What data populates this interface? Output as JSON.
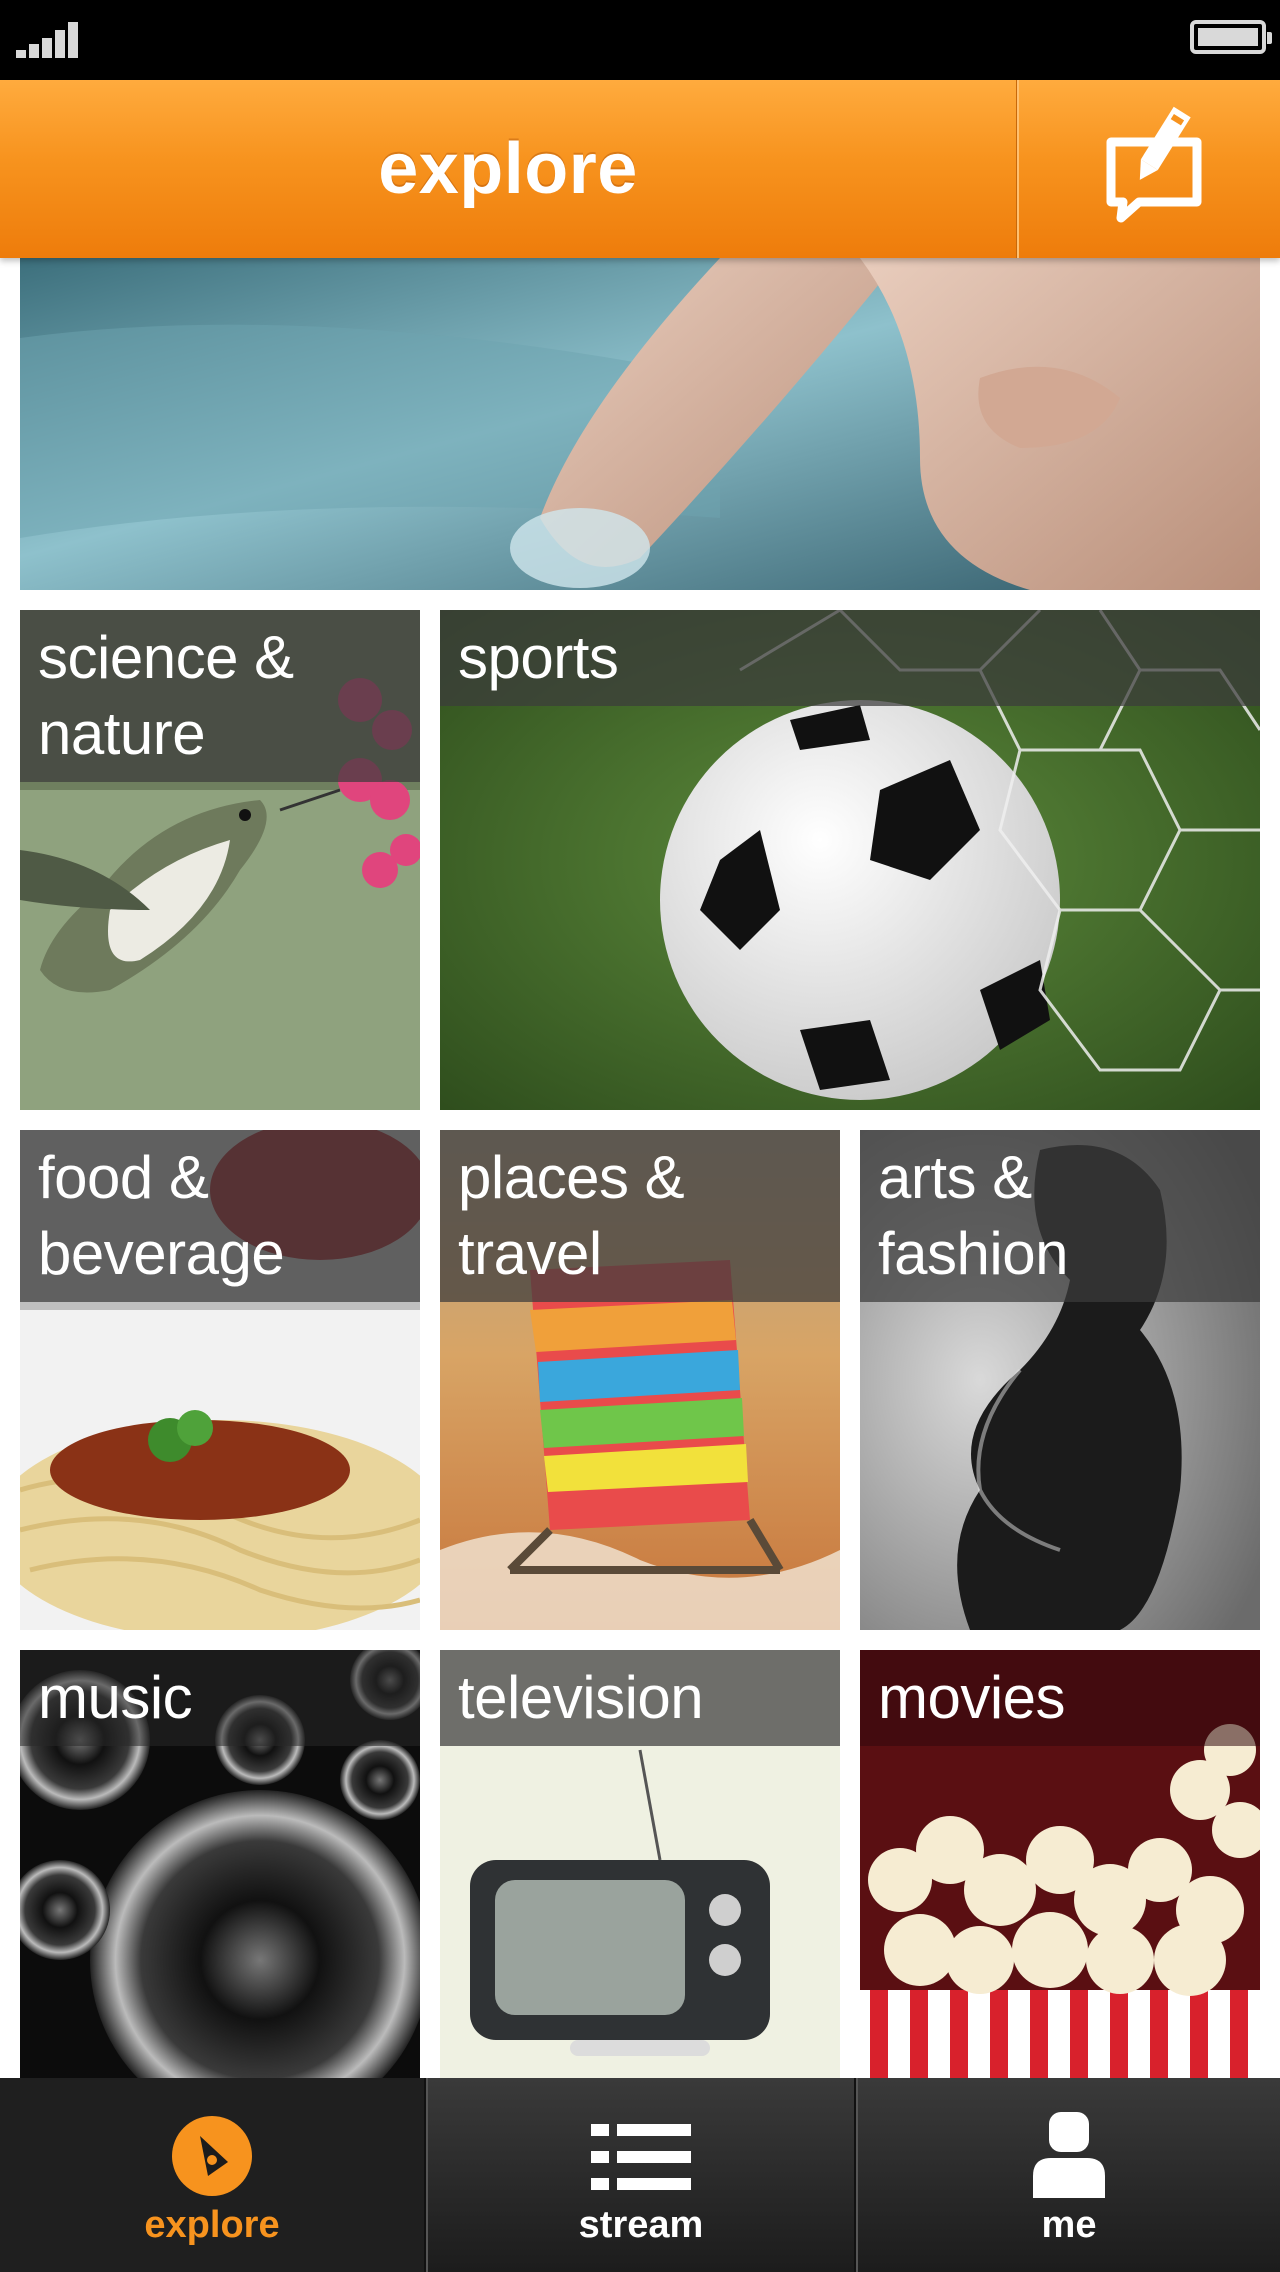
{
  "header": {
    "title": "explore",
    "compose_icon": "compose-bubble-pencil-icon"
  },
  "status_bar": {
    "signal_icon": "signal-strength-icon",
    "battery_icon": "battery-icon"
  },
  "banner": {
    "alt": "hero-banner"
  },
  "categories": [
    {
      "label_line1": "science &",
      "label_line2": "nature"
    },
    {
      "label_line1": "sports",
      "label_line2": ""
    },
    {
      "label_line1": "food &",
      "label_line2": "beverage"
    },
    {
      "label_line1": "places &",
      "label_line2": "travel"
    },
    {
      "label_line1": "arts &",
      "label_line2": "fashion"
    },
    {
      "label_line1": "music",
      "label_line2": ""
    },
    {
      "label_line1": "television",
      "label_line2": ""
    },
    {
      "label_line1": "movies",
      "label_line2": ""
    }
  ],
  "nav": {
    "items": [
      {
        "label": "explore",
        "icon": "compass-icon",
        "active": true
      },
      {
        "label": "stream",
        "icon": "list-icon",
        "active": false
      },
      {
        "label": "me",
        "icon": "person-icon",
        "active": false
      }
    ]
  },
  "colors": {
    "accent": "#f7931e",
    "nav_bg": "#2a2a2a",
    "label_overlay": "#3c3c3c"
  }
}
